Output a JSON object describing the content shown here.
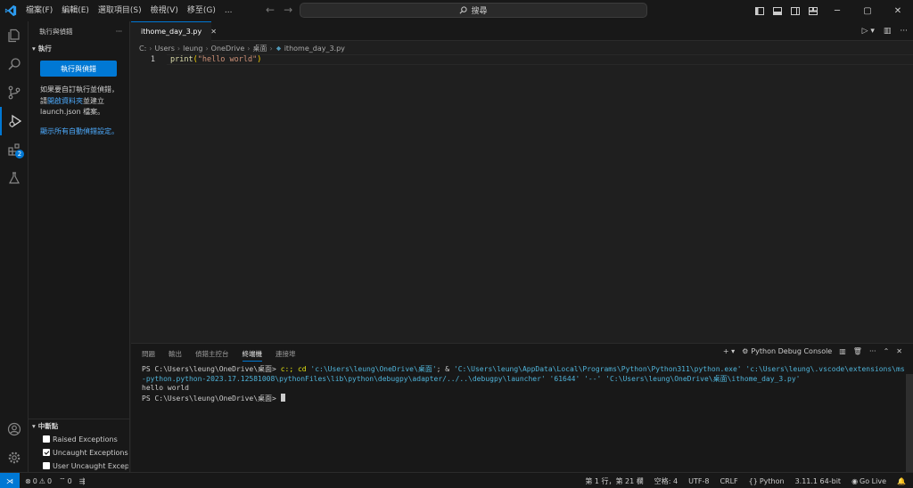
{
  "menu": [
    "檔案(F)",
    "編輯(E)",
    "選取項目(S)",
    "檢視(V)",
    "移至(G)",
    "..."
  ],
  "search": {
    "label": "搜尋"
  },
  "sidebar": {
    "title": "執行與偵錯",
    "section_run": "執行",
    "run_button": "執行與偵錯",
    "text_1": "如果要自訂執行並偵錯，請",
    "text_link": "開啟資料夾",
    "text_2": "並建立 launch.json 檔案。",
    "show_all_link": "顯示所有自動偵錯設定。",
    "breakpoints_title": "中斷點",
    "breakpoints": [
      {
        "label": "Raised Exceptions",
        "checked": false
      },
      {
        "label": "Uncaught Exceptions",
        "checked": true
      },
      {
        "label": "User Uncaught Exceptions",
        "checked": false
      }
    ]
  },
  "activity": {
    "extensions_badge": "2"
  },
  "editor": {
    "tab_label": "ithome_day_3.py",
    "breadcrumb": [
      "C:",
      "Users",
      "leung",
      "OneDrive",
      "桌面",
      "ithome_day_3.py"
    ],
    "line_number": "1",
    "code": {
      "fn": "print",
      "open": "(",
      "str": "\"hello world\"",
      "close": ")"
    }
  },
  "panel": {
    "tabs": [
      "問題",
      "輸出",
      "偵錯主控台",
      "終端機",
      "連接埠"
    ],
    "active_tab": "終端機",
    "terminal_name": "Python Debug Console",
    "lines": {
      "l1_prompt": "PS C:\\Users\\leung\\OneDrive\\桌面> ",
      "l1_cmd": "c:; cd ",
      "l1_path": "'c:\\Users\\leung\\OneDrive\\桌面'",
      "l1_amp": "; & ",
      "l1_args": "'C:\\Users\\leung\\AppData\\Local\\Programs\\Python\\Python311\\python.exe' 'c:\\Users\\leung\\.vscode\\extensions\\ms-python.python-2023.17.12581008\\pythonFiles\\lib\\python\\debugpy\\adapter/../..\\debugpy\\launcher' '61644' '--' 'C:\\Users\\leung\\OneDrive\\桌面\\ithome_day_3.py'",
      "l2": "hello world",
      "l3_prompt": "PS C:\\Users\\leung\\OneDrive\\桌面> "
    }
  },
  "status": {
    "errors": "0",
    "warnings": "0",
    "ports": "0",
    "position": "第 1 行，第 21 欄",
    "spaces": "空格: 4",
    "encoding": "UTF-8",
    "eol": "CRLF",
    "language": "Python",
    "interpreter": "3.11.1 64-bit",
    "golive": "Go Live"
  }
}
